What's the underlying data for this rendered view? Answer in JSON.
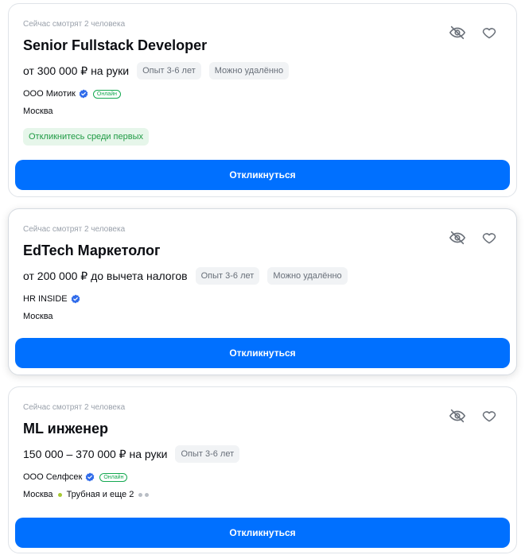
{
  "common": {
    "apply_label": "Откликнуться",
    "online_label": "Онлайн",
    "accent_color": "#0070ff"
  },
  "vacancies": [
    {
      "viewers": "Сейчас смотрят 2 человека",
      "title": "Senior Fullstack Developer",
      "salary": "от 300 000 ₽ на руки",
      "tags": [
        "Опыт 3-6 лет",
        "Можно удалённо"
      ],
      "company": "ООО Миотик",
      "city": "Москва",
      "badge": "Откликнитесь среди первых"
    },
    {
      "viewers": "Сейчас смотрят 2 человека",
      "title": "EdTech Маркетолог",
      "salary": "от 200 000 ₽ до вычета налогов",
      "tags": [
        "Опыт 3-6 лет",
        "Можно удалённо"
      ],
      "company": "HR INSIDE",
      "city": "Москва"
    },
    {
      "viewers": "Сейчас смотрят 2 человека",
      "title": "ML инженер",
      "salary": "150 000 – 370 000 ₽ на руки",
      "tags": [
        "Опыт 3-6 лет"
      ],
      "company": "ООО Селфсек",
      "city": "Москва",
      "metro": "Трубная и еще 2"
    }
  ]
}
